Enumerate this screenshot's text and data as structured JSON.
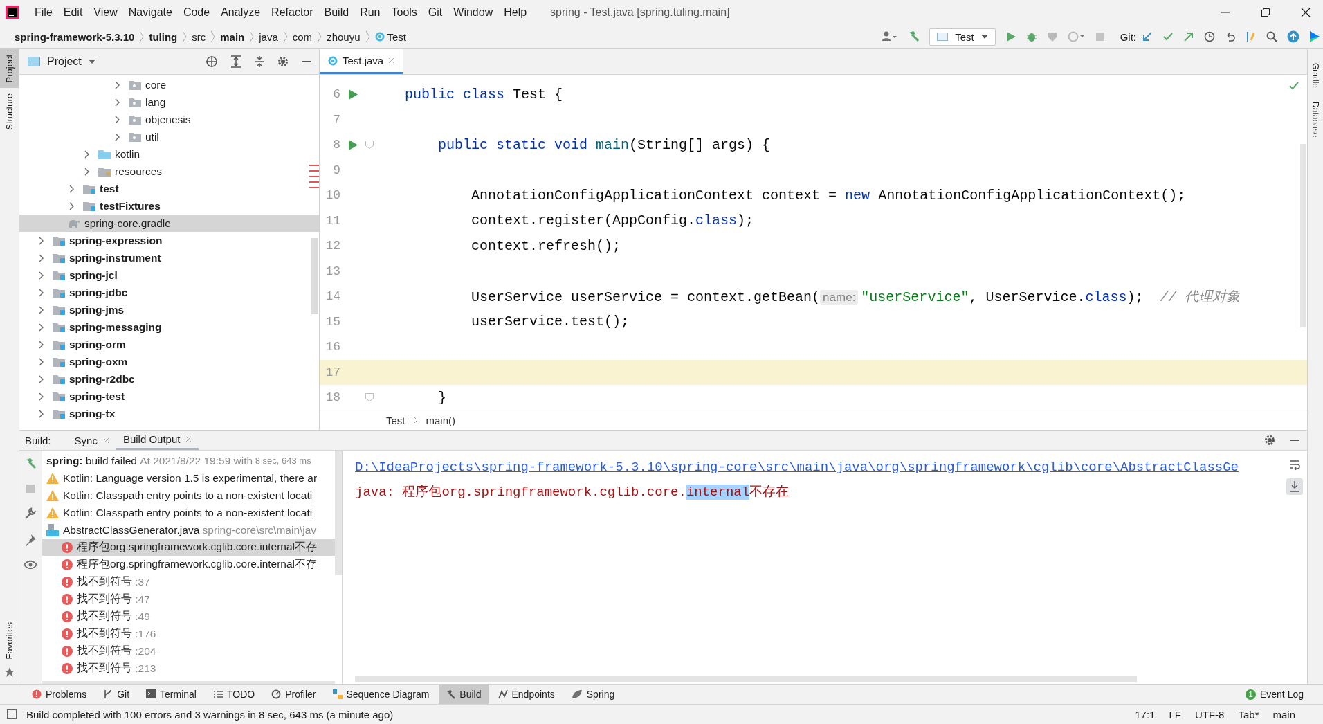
{
  "window": {
    "title": "spring - Test.java [spring.tuling.main]"
  },
  "menu": [
    "File",
    "Edit",
    "View",
    "Navigate",
    "Code",
    "Analyze",
    "Refactor",
    "Build",
    "Run",
    "Tools",
    "Git",
    "Window",
    "Help"
  ],
  "breadcrumb": [
    {
      "label": "spring-framework-5.3.10",
      "emphasized": true,
      "kind": "folder"
    },
    {
      "label": "tuling",
      "emphasized": true,
      "kind": "folder"
    },
    {
      "label": "src",
      "emphasized": false,
      "kind": "folder"
    },
    {
      "label": "main",
      "emphasized": true,
      "kind": "folder"
    },
    {
      "label": "java",
      "emphasized": false,
      "kind": "folder"
    },
    {
      "label": "com",
      "emphasized": false,
      "kind": "folder"
    },
    {
      "label": "zhouyu",
      "emphasized": false,
      "kind": "folder"
    },
    {
      "label": "Test",
      "emphasized": false,
      "kind": "class"
    }
  ],
  "toolbar": {
    "run_config": "Test",
    "git_label": "Git:"
  },
  "left_strip": [
    {
      "label": "Project",
      "selected": true
    },
    {
      "label": "Structure",
      "selected": false
    }
  ],
  "left_strip_bottom": [
    {
      "label": "Favorites",
      "selected": false
    }
  ],
  "right_strip": [
    "Gradle",
    "Database"
  ],
  "project": {
    "title": "Project",
    "tree": [
      {
        "children": [
          {
            "children": [
              {
                "children": [
                  {
                    "children": [
                      {
                        "children": [
                          {
                            "label": "core",
                            "kind": "package",
                            "emphasized": false,
                            "expanded": false,
                            "selected": false
                          },
                          {
                            "label": "lang",
                            "kind": "package",
                            "emphasized": false,
                            "expanded": false,
                            "selected": false
                          },
                          {
                            "label": "objenesis",
                            "kind": "package",
                            "emphasized": false,
                            "expanded": false,
                            "selected": false
                          },
                          {
                            "label": "util",
                            "kind": "package",
                            "emphasized": false,
                            "expanded": false,
                            "selected": false
                          }
                        ]
                      }
                    ]
                  },
                  {
                    "label": "kotlin",
                    "kind": "source",
                    "emphasized": false,
                    "expanded": false,
                    "selected": false
                  },
                  {
                    "label": "resources",
                    "kind": "resources",
                    "emphasized": false,
                    "expanded": false,
                    "selected": false
                  }
                ]
              },
              {
                "label": "test",
                "kind": "module",
                "emphasized": true,
                "expanded": false,
                "selected": false
              },
              {
                "label": "testFixtures",
                "kind": "module",
                "emphasized": true,
                "expanded": false,
                "selected": false
              }
            ]
          },
          {
            "label": "spring-core.gradle",
            "kind": "gradle",
            "emphasized": false,
            "selected": true
          }
        ]
      },
      {
        "label": "spring-expression",
        "kind": "module",
        "emphasized": true,
        "expanded": false,
        "selected": false
      },
      {
        "label": "spring-instrument",
        "kind": "module",
        "emphasized": true,
        "expanded": false,
        "selected": false
      },
      {
        "label": "spring-jcl",
        "kind": "module",
        "emphasized": true,
        "expanded": false,
        "selected": false
      },
      {
        "label": "spring-jdbc",
        "kind": "module",
        "emphasized": true,
        "expanded": false,
        "selected": false
      },
      {
        "label": "spring-jms",
        "kind": "module",
        "emphasized": true,
        "expanded": false,
        "selected": false
      },
      {
        "label": "spring-messaging",
        "kind": "module",
        "emphasized": true,
        "expanded": false,
        "selected": false
      },
      {
        "label": "spring-orm",
        "kind": "module",
        "emphasized": true,
        "expanded": false,
        "selected": false
      },
      {
        "label": "spring-oxm",
        "kind": "module",
        "emphasized": true,
        "expanded": false,
        "selected": false
      },
      {
        "label": "spring-r2dbc",
        "kind": "module",
        "emphasized": true,
        "expanded": false,
        "selected": false
      },
      {
        "label": "spring-test",
        "kind": "module",
        "emphasized": true,
        "expanded": false,
        "selected": false
      },
      {
        "label": "spring-tx",
        "kind": "module",
        "emphasized": true,
        "expanded": false,
        "selected": false
      }
    ]
  },
  "editor": {
    "tabs": [
      {
        "label": "Test.java",
        "selected": true
      }
    ],
    "lines": [
      {
        "number": "6",
        "run": true,
        "fold": false,
        "current": false,
        "tokens": [
          {
            "text": "public class",
            "kind": "keyword"
          },
          {
            "text": " Test {",
            "kind": "plain"
          }
        ]
      },
      {
        "number": "7",
        "run": false,
        "fold": false,
        "current": false
      },
      {
        "number": "8",
        "run": true,
        "fold": true,
        "current": false,
        "tokens": [
          {
            "text": "    public static void ",
            "kind": "keyword"
          },
          {
            "text": "main",
            "kind": "method"
          },
          {
            "text": "(String[] args) {",
            "kind": "plain"
          }
        ]
      },
      {
        "number": "9",
        "run": false,
        "fold": false,
        "current": false
      },
      {
        "number": "10",
        "run": false,
        "fold": false,
        "current": false,
        "tokens": [
          {
            "text": "        AnnotationConfigApplicationContext context = ",
            "kind": "plain"
          },
          {
            "text": "new",
            "kind": "keyword"
          },
          {
            "text": " AnnotationConfigApplicationContext();",
            "kind": "plain"
          }
        ]
      },
      {
        "number": "11",
        "run": false,
        "fold": false,
        "current": false,
        "tokens": [
          {
            "text": "        context.register(AppConfig.",
            "kind": "plain"
          },
          {
            "text": "class",
            "kind": "keyword"
          },
          {
            "text": ");",
            "kind": "plain"
          }
        ]
      },
      {
        "number": "12",
        "run": false,
        "fold": false,
        "current": false,
        "tokens": [
          {
            "text": "        context.refresh();",
            "kind": "plain"
          }
        ]
      },
      {
        "number": "13",
        "run": false,
        "fold": false,
        "current": false
      },
      {
        "number": "14",
        "run": false,
        "fold": false,
        "current": false,
        "tokens": [
          {
            "text": "        UserService userService = context.getBean(",
            "kind": "plain"
          },
          {
            "text": "name:",
            "kind": "hint"
          },
          {
            "text": "\"userService\"",
            "kind": "string"
          },
          {
            "text": ", UserService.",
            "kind": "plain"
          },
          {
            "text": "class",
            "kind": "keyword"
          },
          {
            "text": ");  ",
            "kind": "plain"
          },
          {
            "text": "// 代理对象",
            "kind": "comment"
          }
        ]
      },
      {
        "number": "15",
        "run": false,
        "fold": false,
        "current": false,
        "tokens": [
          {
            "text": "        userService.test();",
            "kind": "plain"
          }
        ]
      },
      {
        "number": "16",
        "run": false,
        "fold": false,
        "current": false
      },
      {
        "number": "17",
        "run": false,
        "fold": false,
        "current": true
      },
      {
        "number": "18",
        "run": false,
        "fold": true,
        "current": false,
        "tokens": [
          {
            "text": "    }",
            "kind": "plain"
          }
        ]
      }
    ],
    "breadcrumb": [
      "Test",
      "main()"
    ]
  },
  "build": {
    "label": "Build:",
    "tabs": [
      {
        "label": "Sync",
        "selected": false
      },
      {
        "label": "Build Output",
        "selected": true
      }
    ],
    "tree": [
      {
        "kind": "summary",
        "text": "**spring:** build failed",
        "detail": "At 2021/8/22 19:59 with",
        "time": "8 sec, 643 ms",
        "selected": false
      },
      {
        "kind": "warning",
        "text": "Kotlin: Language version 1.5 is experimental, there ar",
        "selected": false
      },
      {
        "kind": "warning",
        "text": "Kotlin: Classpath entry points to a non-existent locati",
        "selected": false
      },
      {
        "kind": "warning",
        "text": "Kotlin: Classpath entry points to a non-existent locati",
        "selected": false
      },
      {
        "kind": "file",
        "text": "AbstractClassGenerator.java",
        "detail": "spring-core\\src\\main\\jav",
        "selected": false,
        "children": [
          {
            "kind": "error",
            "text": "程序包org.springframework.cglib.core.internal不存",
            "selected": true
          },
          {
            "kind": "error",
            "text": "程序包org.springframework.cglib.core.internal不存",
            "selected": false
          },
          {
            "kind": "error",
            "text": "找不到符号",
            "detail": ":37",
            "selected": false
          },
          {
            "kind": "error",
            "text": "找不到符号",
            "detail": ":47",
            "selected": false
          },
          {
            "kind": "error",
            "text": "找不到符号",
            "detail": ":49",
            "selected": false
          },
          {
            "kind": "error",
            "text": "找不到符号",
            "detail": ":176",
            "selected": false
          },
          {
            "kind": "error",
            "text": "找不到符号",
            "detail": ":204",
            "selected": false
          },
          {
            "kind": "error",
            "text": "找不到符号",
            "detail": ":213",
            "selected": false
          }
        ]
      }
    ],
    "output": {
      "link": "D:\\IdeaProjects\\spring-framework-5.3.10\\spring-core\\src\\main\\java\\org\\springframework\\cglib\\core\\AbstractClassGe",
      "message": [
        {
          "text": "java: 程序包org.springframework.cglib.core.",
          "selected": false
        },
        {
          "text": "internal",
          "selected": true
        },
        {
          "text": "不存在",
          "selected": false
        }
      ]
    }
  },
  "tool_windows": [
    {
      "label": "Problems",
      "kind": "problems",
      "selected": false
    },
    {
      "label": "Git",
      "kind": "git",
      "selected": false
    },
    {
      "label": "Terminal",
      "kind": "terminal",
      "selected": false
    },
    {
      "label": "TODO",
      "kind": "todo",
      "selected": false
    },
    {
      "label": "Profiler",
      "kind": "profiler",
      "selected": false
    },
    {
      "label": "Sequence Diagram",
      "kind": "diagram",
      "selected": false
    },
    {
      "label": "Build",
      "kind": "build",
      "selected": true
    },
    {
      "label": "Endpoints",
      "kind": "endpoints",
      "selected": false
    },
    {
      "label": "Spring",
      "kind": "spring",
      "selected": false
    }
  ],
  "event_log": {
    "label": "Event Log",
    "badge": "1"
  },
  "status_bar": {
    "message": "Build completed with 100 errors and 3 warnings in 8 sec, 643 ms (a minute ago)",
    "items": [
      "17:1",
      "LF",
      "UTF-8",
      "Tab*",
      "main"
    ]
  }
}
